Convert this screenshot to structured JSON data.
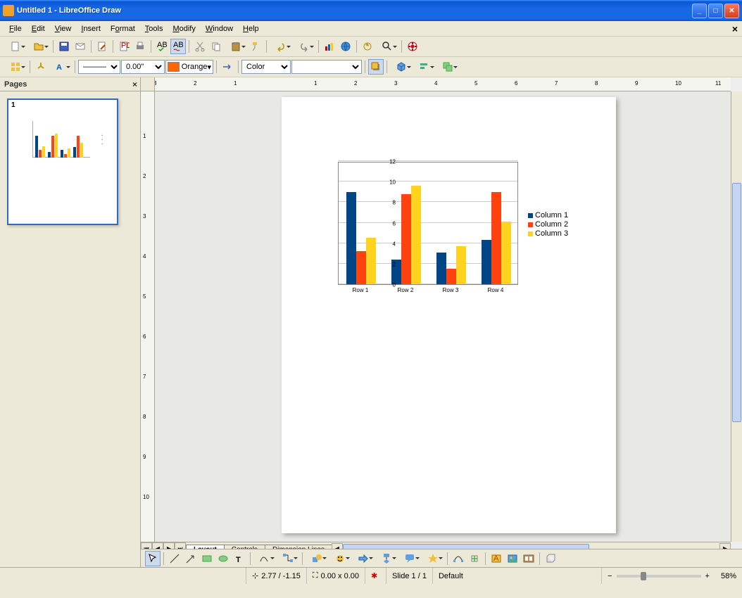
{
  "titlebar": {
    "title": "Untitled 1 - LibreOffice Draw"
  },
  "menu": {
    "file": "File",
    "edit": "Edit",
    "view": "View",
    "insert": "Insert",
    "format": "Format",
    "tools": "Tools",
    "modify": "Modify",
    "window": "Window",
    "help": "Help"
  },
  "toolbar2": {
    "line_width": "0.00\"",
    "line_color": "Orange",
    "fill_style": "Color"
  },
  "panels": {
    "pages_title": "Pages",
    "page_number": "1"
  },
  "layer_tabs": {
    "layout": "Layout",
    "controls": "Controls",
    "dimension": "Dimension Lines"
  },
  "statusbar": {
    "pos": "2.77 / -1.15",
    "size": "0.00 x 0.00",
    "slide": "Slide 1 / 1",
    "style": "Default",
    "zoom": "58%"
  },
  "ruler_h": [
    "3",
    "2",
    "1",
    "",
    "1",
    "2",
    "3",
    "4",
    "5",
    "6",
    "7",
    "8",
    "9",
    "10",
    "11"
  ],
  "ruler_v": [
    "",
    "1",
    "2",
    "3",
    "4",
    "5",
    "6",
    "7",
    "8",
    "9",
    "10"
  ],
  "chart_data": {
    "type": "bar",
    "categories": [
      "Row 1",
      "Row 2",
      "Row 3",
      "Row 4"
    ],
    "series": [
      {
        "name": "Column 1",
        "values": [
          9.0,
          2.4,
          3.1,
          4.3
        ],
        "color": "#004586"
      },
      {
        "name": "Column 2",
        "values": [
          3.2,
          8.8,
          1.5,
          9.0
        ],
        "color": "#ff420e"
      },
      {
        "name": "Column 3",
        "values": [
          4.5,
          9.6,
          3.7,
          6.1
        ],
        "color": "#ffd320"
      }
    ],
    "ylim": [
      0,
      12
    ],
    "yticks": [
      0,
      2,
      4,
      6,
      8,
      10,
      12
    ],
    "title": "",
    "xlabel": "",
    "ylabel": ""
  }
}
